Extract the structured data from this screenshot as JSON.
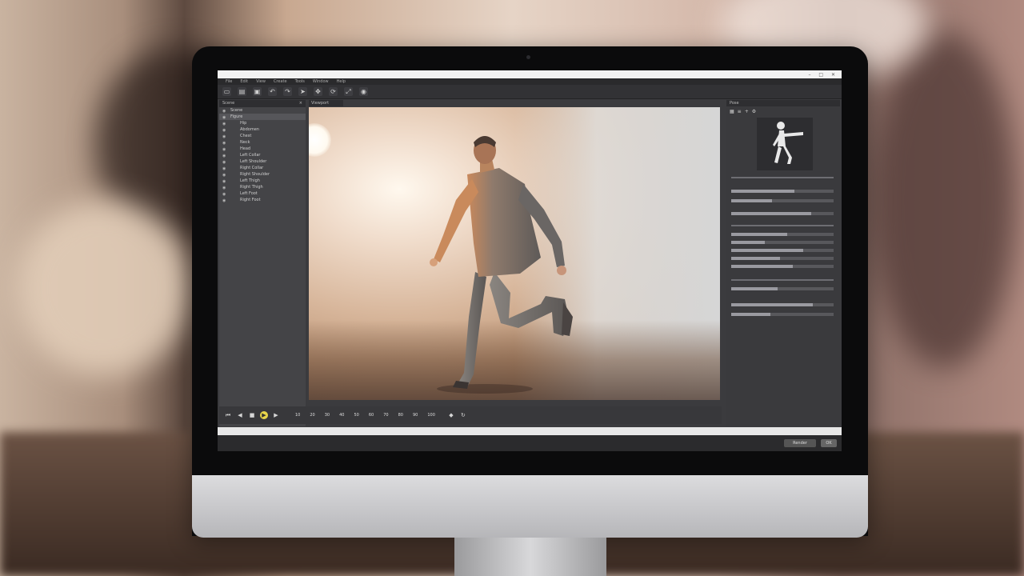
{
  "app": {
    "window_title": "",
    "window_buttons": "–  □  ✕",
    "menu": [
      "File",
      "Edit",
      "View",
      "Create",
      "Tools",
      "Window",
      "Help"
    ]
  },
  "toolbar": {
    "icons": [
      "new-file-icon",
      "open-file-icon",
      "save-icon",
      "undo-icon",
      "redo-icon",
      "select-icon",
      "move-icon",
      "rotate-icon",
      "scale-icon",
      "render-icon"
    ]
  },
  "left_panel": {
    "title": "Scene",
    "close": "×",
    "rows": [
      {
        "label": "Scene",
        "indent": false,
        "selected": false
      },
      {
        "label": "Figure",
        "indent": false,
        "selected": true
      },
      {
        "label": "Hip",
        "indent": true,
        "selected": false
      },
      {
        "label": "Abdomen",
        "indent": true,
        "selected": false
      },
      {
        "label": "Chest",
        "indent": true,
        "selected": false
      },
      {
        "label": "Neck",
        "indent": true,
        "selected": false
      },
      {
        "label": "Head",
        "indent": true,
        "selected": false
      },
      {
        "label": "Left Collar",
        "indent": true,
        "selected": false
      },
      {
        "label": "Left Shoulder",
        "indent": true,
        "selected": false
      },
      {
        "label": "Right Collar",
        "indent": true,
        "selected": false
      },
      {
        "label": "Right Shoulder",
        "indent": true,
        "selected": false
      },
      {
        "label": "Left Thigh",
        "indent": true,
        "selected": false
      },
      {
        "label": "Right Thigh",
        "indent": true,
        "selected": false
      },
      {
        "label": "Left Foot",
        "indent": true,
        "selected": false
      },
      {
        "label": "Right Foot",
        "indent": true,
        "selected": false
      }
    ]
  },
  "viewport": {
    "tab_label": "Viewport"
  },
  "right_panel": {
    "title": "Pose"
  },
  "timeline": {
    "frames": [
      "10",
      "20",
      "30",
      "40",
      "50",
      "60",
      "70",
      "80",
      "90",
      "100"
    ]
  },
  "status": {
    "text": ""
  },
  "bottom": {
    "button_label": "Render",
    "button2_label": "OK"
  },
  "colors": {
    "ui_dark": "#3b3b3e",
    "accent_yellow": "#e8d64a"
  }
}
